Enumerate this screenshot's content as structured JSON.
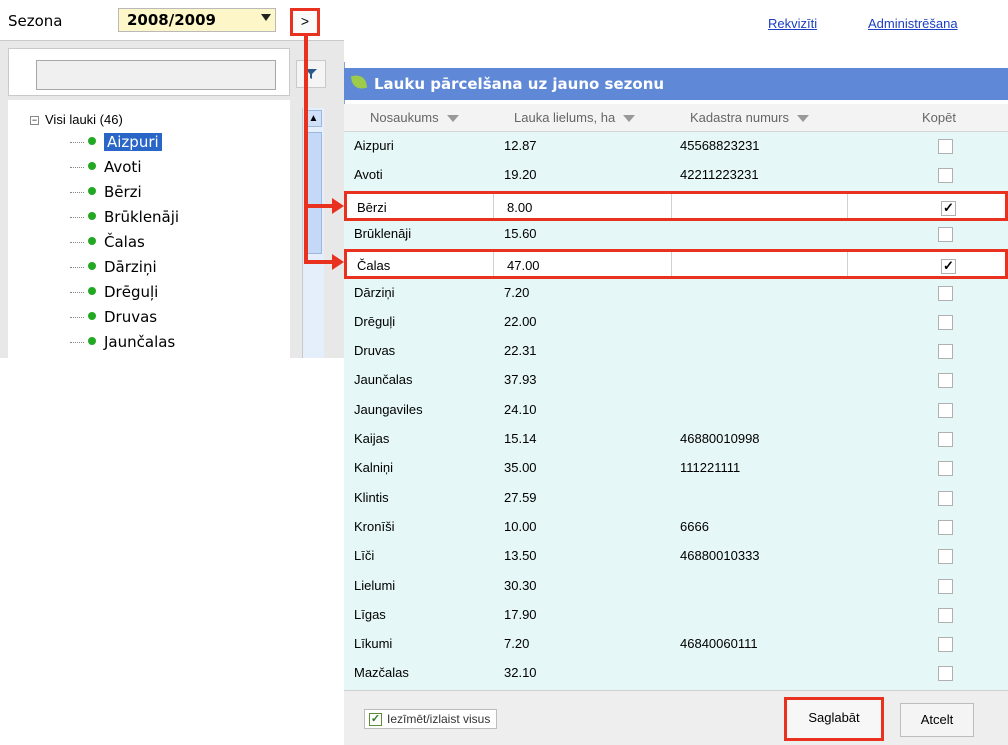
{
  "header": {
    "season_label": "Sezona",
    "season_value": "2008/2009",
    "expand_button": ">",
    "links": [
      "Rekvizīti",
      "Administrēšana"
    ]
  },
  "sidebar": {
    "tree_root": "Visi lauki (46)",
    "items": [
      "Aizpuri",
      "Avoti",
      "Bērzi",
      "Brūklenāji",
      "Čalas",
      "Dārziņi",
      "Drēguļi",
      "Druvas",
      "Jaunčalas"
    ],
    "selected_item": "Aizpuri"
  },
  "dialog": {
    "title": "Lauku pārcelšana uz jauno sezonu",
    "columns": [
      "Nosaukums",
      "Lauka lielums, ha",
      "Kadastra numurs",
      "Kopēt"
    ],
    "rows": [
      {
        "name": "Aizpuri",
        "size": "12.87",
        "cadastre": "45568823231",
        "copy": false
      },
      {
        "name": "Avoti",
        "size": "19.20",
        "cadastre": "42211223231",
        "copy": false
      },
      {
        "name": "Bērzi",
        "size": "8.00",
        "cadastre": "",
        "copy": true
      },
      {
        "name": "Brūklenāji",
        "size": "15.60",
        "cadastre": "",
        "copy": false
      },
      {
        "name": "Čalas",
        "size": "47.00",
        "cadastre": "",
        "copy": true
      },
      {
        "name": "Dārziņi",
        "size": "7.20",
        "cadastre": "",
        "copy": false
      },
      {
        "name": "Drēguļi",
        "size": "22.00",
        "cadastre": "",
        "copy": false
      },
      {
        "name": "Druvas",
        "size": "22.31",
        "cadastre": "",
        "copy": false
      },
      {
        "name": "Jaunčalas",
        "size": "37.93",
        "cadastre": "",
        "copy": false
      },
      {
        "name": "Jaungaviles",
        "size": "24.10",
        "cadastre": "",
        "copy": false
      },
      {
        "name": "Kaijas",
        "size": "15.14",
        "cadastre": "46880010998",
        "copy": false
      },
      {
        "name": "Kalniņi",
        "size": "35.00",
        "cadastre": "111221111",
        "copy": false
      },
      {
        "name": "Klintis",
        "size": "27.59",
        "cadastre": "",
        "copy": false
      },
      {
        "name": "Kronīši",
        "size": "10.00",
        "cadastre": "6666",
        "copy": false
      },
      {
        "name": "Līči",
        "size": "13.50",
        "cadastre": "46880010333",
        "copy": false
      },
      {
        "name": "Lielumi",
        "size": "30.30",
        "cadastre": "",
        "copy": false
      },
      {
        "name": "Līgas",
        "size": "17.90",
        "cadastre": "",
        "copy": false
      },
      {
        "name": "Līkumi",
        "size": "7.20",
        "cadastre": "46840060111",
        "copy": false
      },
      {
        "name": "Mazčalas",
        "size": "32.10",
        "cadastre": "",
        "copy": false
      }
    ],
    "select_all_label": "Iezīmēt/izlaist visus",
    "save_label": "Saglabāt",
    "cancel_label": "Atcelt"
  },
  "colors": {
    "highlight": "#e8321f",
    "title_bar": "#5f88d6",
    "row_bg": "#e6f7f7",
    "season_bg": "#fdf6c8"
  }
}
